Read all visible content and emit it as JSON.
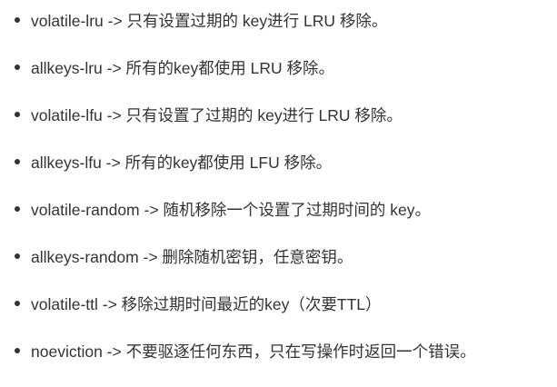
{
  "items": [
    {
      "text": "volatile-lru -> 只有设置过期的 key进行 LRU 移除。"
    },
    {
      "text": "allkeys-lru -> 所有的key都使用 LRU 移除。"
    },
    {
      "text": "volatile-lfu -> 只有设置了过期的 key进行 LRU 移除。"
    },
    {
      "text": "allkeys-lfu -> 所有的key都使用 LFU 移除。"
    },
    {
      "text": "volatile-random -> 随机移除一个设置了过期时间的 key。"
    },
    {
      "text": "allkeys-random -> 删除随机密钥，任意密钥。"
    },
    {
      "text": "volatile-ttl -> 移除过期时间最近的key（次要TTL）"
    },
    {
      "text": "noeviction -> 不要驱逐任何东西，只在写操作时返回一个错误。"
    }
  ]
}
